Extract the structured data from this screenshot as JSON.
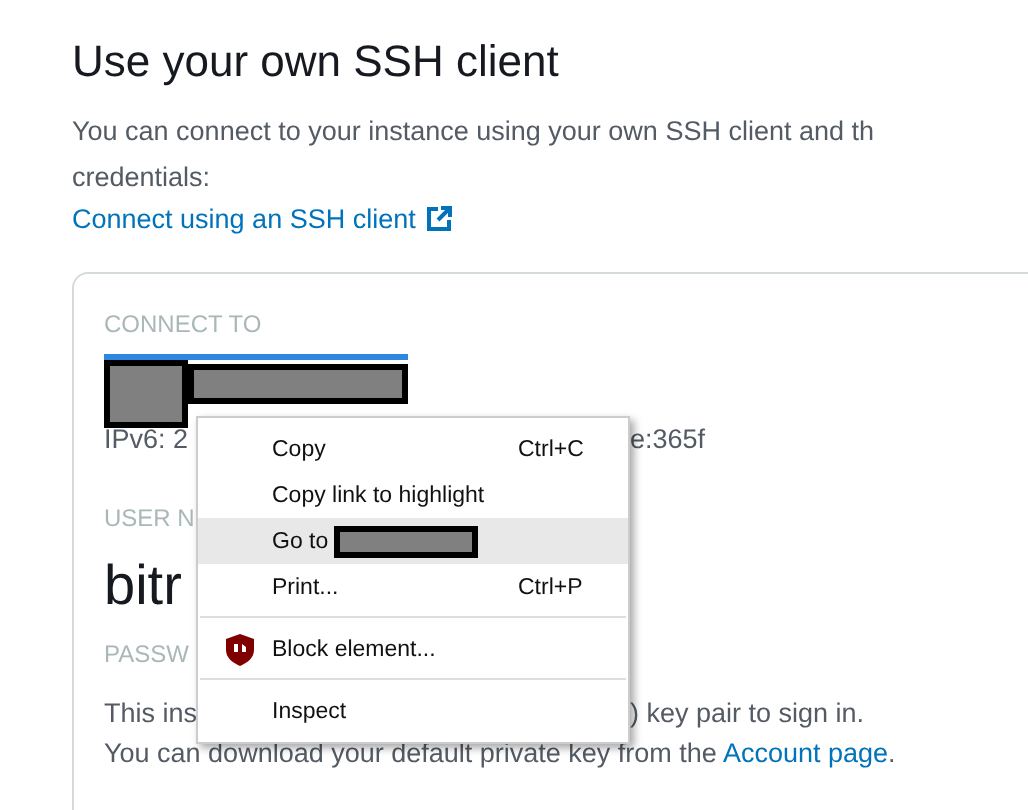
{
  "section": {
    "title": "Use your own SSH client",
    "intro_lines": [
      "You can connect to your instance using your own SSH client and th",
      "credentials:"
    ],
    "link": "Connect using an SSH client"
  },
  "card": {
    "connect_label": "CONNECT TO",
    "target_redacted": true,
    "ipv6_left": "IPv6: 2",
    "ipv6_right": "e:365f",
    "user_label": "USER N",
    "user_value": "bitr",
    "password_label": "PASSW",
    "password_left": "This ins",
    "password_right": ") key pair to sign in.",
    "download_text": "You can download your default private key from the ",
    "download_link": "Account page",
    "download_end": "."
  },
  "context_menu": [
    {
      "kind": "item",
      "label": "Copy",
      "shortcut": "Ctrl+C",
      "highlighted": false,
      "redacted": false
    },
    {
      "kind": "item",
      "label": "Copy link to highlight",
      "highlighted": false,
      "redacted": false
    },
    {
      "kind": "item",
      "label": "Go to",
      "highlighted": true,
      "redacted": true
    },
    {
      "kind": "item",
      "label": "Print...",
      "shortcut": "Ctrl+P",
      "highlighted": false,
      "redacted": false
    },
    {
      "kind": "separator"
    },
    {
      "kind": "extension",
      "label": "Block element...",
      "highlighted": false,
      "redacted": false
    },
    {
      "kind": "separator"
    },
    {
      "kind": "item",
      "label": "Inspect",
      "highlighted": false,
      "redacted": false
    }
  ]
}
